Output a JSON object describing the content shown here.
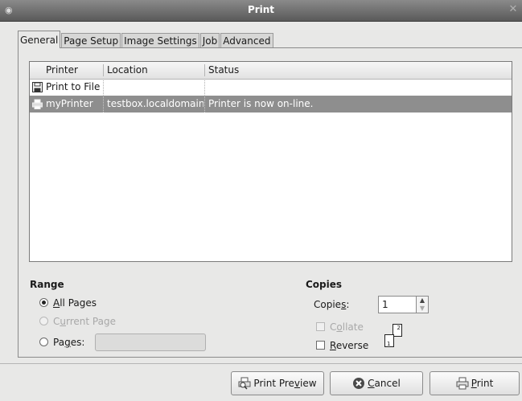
{
  "window": {
    "title": "Print"
  },
  "tabs": [
    {
      "label": "General",
      "active": true
    },
    {
      "label": "Page Setup",
      "active": false
    },
    {
      "label": "Image Settings",
      "active": false
    },
    {
      "label": "Job",
      "active": false
    },
    {
      "label": "Advanced",
      "active": false
    }
  ],
  "printer_list": {
    "columns": [
      "Printer",
      "Location",
      "Status"
    ],
    "rows": [
      {
        "icon": "floppy-disk-icon",
        "printer": "Print to File",
        "location": "",
        "status": "",
        "selected": false
      },
      {
        "icon": "printer-icon",
        "printer": "myPrinter",
        "location": "testbox.localdomain",
        "status": "Printer is now on-line.",
        "selected": true
      }
    ]
  },
  "range": {
    "title": "Range",
    "all_pages": {
      "pre": "",
      "mnemonic": "A",
      "post": "ll Pages",
      "checked": true,
      "enabled": true
    },
    "current_page": {
      "pre": "C",
      "mnemonic": "u",
      "post": "rrent Page",
      "checked": false,
      "enabled": false
    },
    "pages": {
      "pre": "Pa",
      "mnemonic": "g",
      "post": "es:",
      "checked": false,
      "enabled": true,
      "value": ""
    }
  },
  "copies": {
    "title": "Copies",
    "label_pre": "Copie",
    "label_mnemonic": "s",
    "label_post": ":",
    "value": "1",
    "collate": {
      "pre": "C",
      "mnemonic": "o",
      "post": "llate",
      "checked": false,
      "enabled": false
    },
    "reverse": {
      "pre": "",
      "mnemonic": "R",
      "post": "everse",
      "checked": false,
      "enabled": true
    },
    "page_icons": [
      "2",
      "1"
    ]
  },
  "buttons": {
    "preview": {
      "pre": "Print Pre",
      "mnemonic": "v",
      "post": "iew"
    },
    "cancel": {
      "pre": "",
      "mnemonic": "C",
      "post": "ancel"
    },
    "print": {
      "pre": "",
      "mnemonic": "P",
      "post": "rint"
    }
  },
  "colors": {
    "selection": "#8e8e8e",
    "cancel_icon": "#4a4a4a"
  }
}
